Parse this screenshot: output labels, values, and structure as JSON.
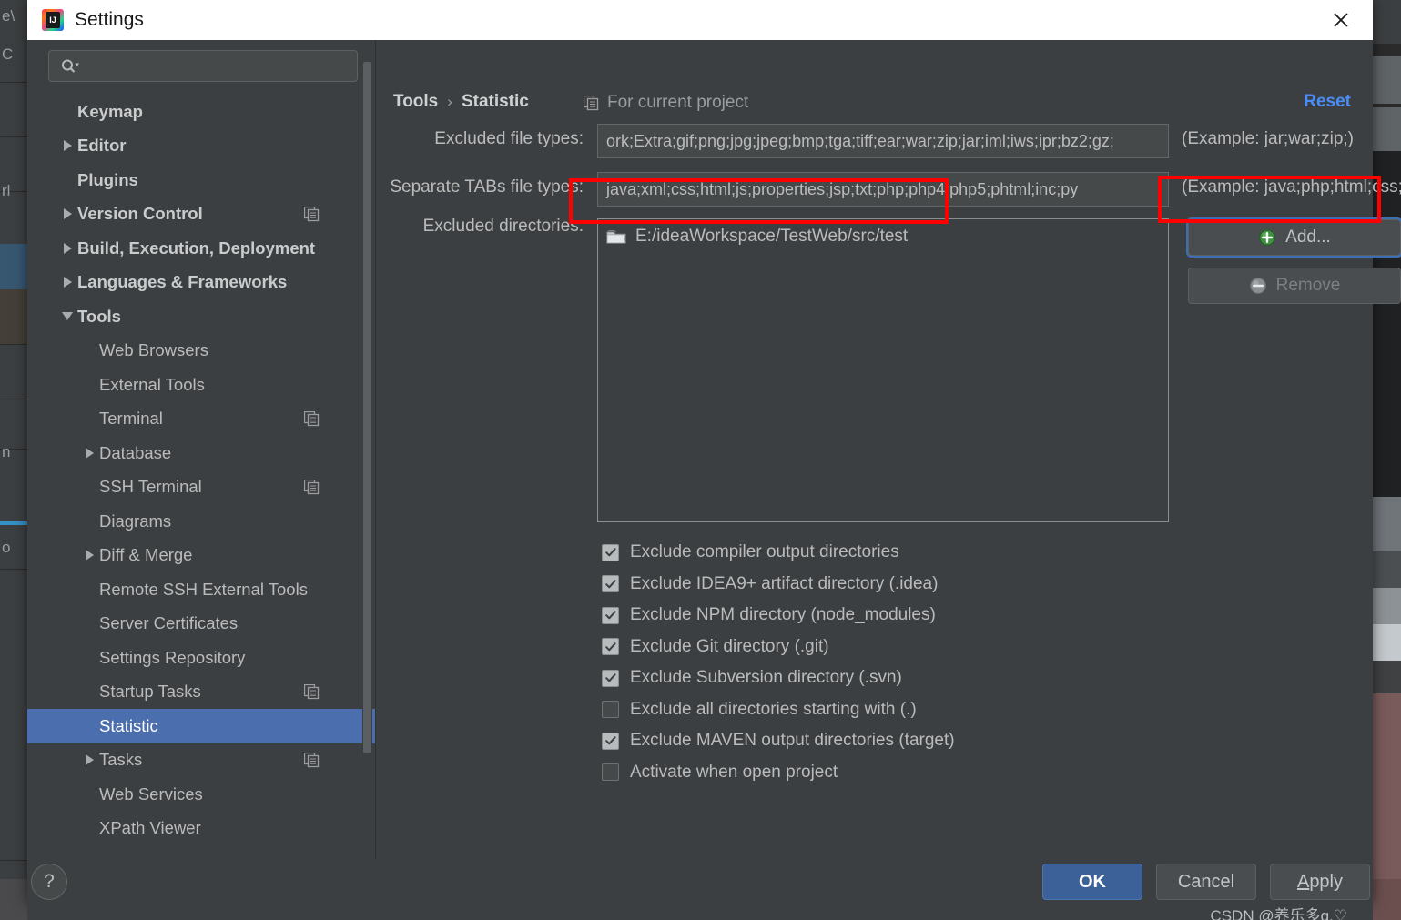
{
  "window": {
    "title": "Settings",
    "logo_text": "IJ",
    "close_icon": "close-icon"
  },
  "sidebar": {
    "search": {
      "placeholder": "",
      "value": "",
      "icon": "search-icon"
    },
    "items": [
      {
        "label": "Keymap",
        "level": 0,
        "bold": true,
        "twisty": "none",
        "copy": false,
        "selected": false
      },
      {
        "label": "Editor",
        "level": 0,
        "bold": true,
        "twisty": "right",
        "copy": false,
        "selected": false
      },
      {
        "label": "Plugins",
        "level": 0,
        "bold": true,
        "twisty": "none",
        "copy": false,
        "selected": false
      },
      {
        "label": "Version Control",
        "level": 0,
        "bold": true,
        "twisty": "right",
        "copy": true,
        "selected": false
      },
      {
        "label": "Build, Execution, Deployment",
        "level": 0,
        "bold": true,
        "twisty": "right",
        "copy": false,
        "selected": false
      },
      {
        "label": "Languages & Frameworks",
        "level": 0,
        "bold": true,
        "twisty": "right",
        "copy": false,
        "selected": false
      },
      {
        "label": "Tools",
        "level": 0,
        "bold": true,
        "twisty": "down",
        "copy": false,
        "selected": false
      },
      {
        "label": "Web Browsers",
        "level": 1,
        "bold": false,
        "twisty": "none",
        "copy": false,
        "selected": false
      },
      {
        "label": "External Tools",
        "level": 1,
        "bold": false,
        "twisty": "none",
        "copy": false,
        "selected": false
      },
      {
        "label": "Terminal",
        "level": 1,
        "bold": false,
        "twisty": "none",
        "copy": true,
        "selected": false
      },
      {
        "label": "Database",
        "level": 1,
        "bold": false,
        "twisty": "right",
        "copy": false,
        "selected": false
      },
      {
        "label": "SSH Terminal",
        "level": 1,
        "bold": false,
        "twisty": "none",
        "copy": true,
        "selected": false
      },
      {
        "label": "Diagrams",
        "level": 1,
        "bold": false,
        "twisty": "none",
        "copy": false,
        "selected": false
      },
      {
        "label": "Diff & Merge",
        "level": 1,
        "bold": false,
        "twisty": "right",
        "copy": false,
        "selected": false
      },
      {
        "label": "Remote SSH External Tools",
        "level": 1,
        "bold": false,
        "twisty": "none",
        "copy": false,
        "selected": false
      },
      {
        "label": "Server Certificates",
        "level": 1,
        "bold": false,
        "twisty": "none",
        "copy": false,
        "selected": false
      },
      {
        "label": "Settings Repository",
        "level": 1,
        "bold": false,
        "twisty": "none",
        "copy": false,
        "selected": false
      },
      {
        "label": "Startup Tasks",
        "level": 1,
        "bold": false,
        "twisty": "none",
        "copy": true,
        "selected": false
      },
      {
        "label": "Statistic",
        "level": 1,
        "bold": false,
        "twisty": "none",
        "copy": true,
        "selected": true
      },
      {
        "label": "Tasks",
        "level": 1,
        "bold": false,
        "twisty": "right",
        "copy": true,
        "selected": false
      },
      {
        "label": "Web Services",
        "level": 1,
        "bold": false,
        "twisty": "none",
        "copy": false,
        "selected": false
      },
      {
        "label": "XPath Viewer",
        "level": 1,
        "bold": false,
        "twisty": "none",
        "copy": false,
        "selected": false
      }
    ]
  },
  "header": {
    "breadcrumb_parent": "Tools",
    "breadcrumb_separator": "›",
    "breadcrumb_current": "Statistic",
    "project_scope_label": "For current project",
    "project_scope_icon": "copy-icon",
    "reset_label": "Reset"
  },
  "form": {
    "excluded_file_types": {
      "label": "Excluded file types:",
      "value": "ork;Extra;gif;png;jpg;jpeg;bmp;tga;tiff;ear;war;zip;jar;iml;iws;ipr;bz2;gz;",
      "hint": "(Example: jar;war;zip;)"
    },
    "separate_tabs_file_types": {
      "label": "Separate TABs file types:",
      "value": "java;xml;css;html;js;properties;jsp;txt;php;php4;php5;phtml;inc;py",
      "hint": "(Example: java;php;html;css;)"
    },
    "excluded_directories": {
      "label": "Excluded directories:",
      "entries": [
        {
          "path": "E:/ideaWorkspace/TestWeb/src/test",
          "icon": "folder-icon"
        }
      ]
    },
    "add_button": {
      "label": "Add...",
      "icon": "plus-circle-icon",
      "enabled": true,
      "focused": true
    },
    "remove_button": {
      "label": "Remove",
      "icon": "minus-circle-icon",
      "enabled": false,
      "focused": false
    },
    "checkboxes": [
      {
        "label": "Exclude compiler output directories",
        "checked": true
      },
      {
        "label": "Exclude IDEA9+ artifact directory (.idea)",
        "checked": true
      },
      {
        "label": "Exclude NPM directory (node_modules)",
        "checked": true
      },
      {
        "label": "Exclude Git directory (.git)",
        "checked": true
      },
      {
        "label": "Exclude Subversion directory (.svn)",
        "checked": true
      },
      {
        "label": "Exclude all directories starting with (.)",
        "checked": false
      },
      {
        "label": "Exclude MAVEN output directories (target)",
        "checked": true
      },
      {
        "label": "Activate when open project",
        "checked": false
      }
    ]
  },
  "footer": {
    "help_label": "?",
    "ok_label": "OK",
    "cancel_label": "Cancel",
    "apply_mnemonic": "A",
    "apply_rest": "pply"
  },
  "watermark": {
    "text": "CSDN @养乐多q.♡"
  },
  "colors": {
    "accent_blue": "#4b6eaf",
    "link_blue": "#4a8df8",
    "primary_button": "#3c6098",
    "annotation_red": "#fe0000",
    "panel_bg": "#3c3f41",
    "input_bg": "#45494a"
  }
}
